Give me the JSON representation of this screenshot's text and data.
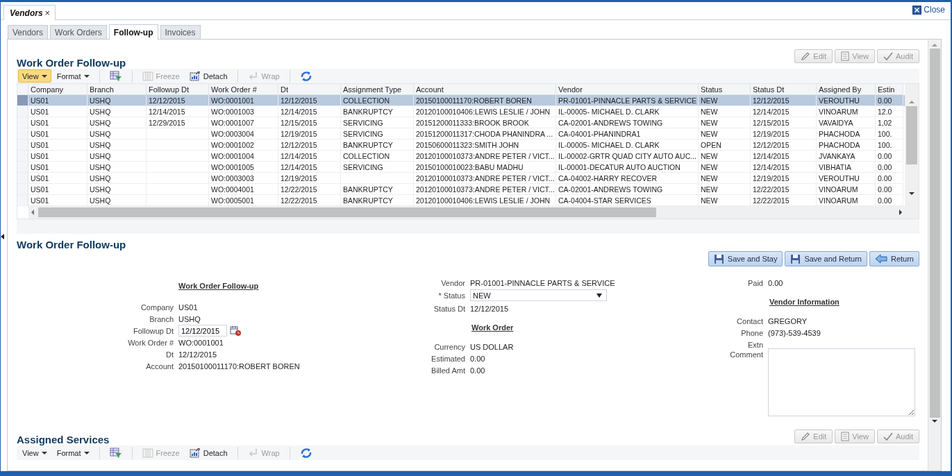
{
  "document_tab": {
    "label": "Vendors",
    "close": "×"
  },
  "close_link": "Close",
  "tabs": [
    {
      "label": "Vendors",
      "selected": false
    },
    {
      "label": "Work Orders",
      "selected": false
    },
    {
      "label": "Follow-up",
      "selected": true
    },
    {
      "label": "Invoices",
      "selected": false
    }
  ],
  "list_section": {
    "title": "Work Order Follow-up",
    "actions": [
      {
        "label": "Edit",
        "kind": "edit",
        "disabled": true
      },
      {
        "label": "View",
        "kind": "view",
        "disabled": true
      },
      {
        "label": "Audit",
        "kind": "audit",
        "disabled": true
      }
    ],
    "toolbar": [
      {
        "kind": "menu",
        "label": "View",
        "highlighted": true,
        "disabled": false
      },
      {
        "kind": "menu",
        "label": "Format",
        "highlighted": false,
        "disabled": false
      },
      {
        "kind": "filter",
        "highlighted": false,
        "disabled": false
      },
      {
        "kind": "freeze",
        "label": "Freeze",
        "highlighted": false,
        "disabled": true
      },
      {
        "kind": "detach",
        "label": "Detach",
        "highlighted": false,
        "disabled": false
      },
      {
        "kind": "wrap",
        "label": "Wrap",
        "highlighted": false,
        "disabled": true
      },
      {
        "kind": "refresh",
        "highlighted": false,
        "disabled": false
      }
    ]
  },
  "table": {
    "columns": [
      "Company",
      "Branch",
      "Followup Dt",
      "Work Order #",
      "Dt",
      "Assignment Type",
      "Account",
      "Vendor",
      "Status",
      "Status Dt",
      "Assigned By",
      "Estin"
    ],
    "rows": [
      {
        "selected": true,
        "cells": [
          "US01",
          "USHQ",
          "12/12/2015",
          "WO:0001001",
          "12/12/2015",
          "COLLECTION",
          "20150100011170:ROBERT BOREN",
          "PR-01001-PINNACLE PARTS & SERVICE",
          "NEW",
          "12/12/2015",
          "VEROUTHU",
          "0.00"
        ]
      },
      {
        "selected": false,
        "cells": [
          "US01",
          "USHQ",
          "12/14/2015",
          "WO:0001003",
          "12/14/2015",
          "BANKRUPTCY",
          "20120100010406:LEWIS LESLIE / JOHN",
          "IL-00005- MICHAEL D. CLARK",
          "NEW",
          "12/14/2015",
          "VINOARUM",
          "12.0"
        ]
      },
      {
        "selected": false,
        "cells": [
          "US01",
          "USHQ",
          "12/29/2015",
          "WO:0001007",
          "12/15/2015",
          "SERVICING",
          "20151200011333:BROOK BROOK",
          "CA-02001-ANDREWS TOWING",
          "NEW",
          "12/15/2015",
          "VAVAIDYA",
          "1,02"
        ]
      },
      {
        "selected": false,
        "cells": [
          "US01",
          "USHQ",
          "",
          "WO:0003004",
          "12/19/2015",
          "SERVICING",
          "20151200011317:CHODA PHANINDRA ...",
          "CA-04001-PHANINDRA1",
          "NEW",
          "12/19/2015",
          "PHACHODA",
          "100."
        ]
      },
      {
        "selected": false,
        "cells": [
          "US01",
          "USHQ",
          "",
          "WO:0001002",
          "12/12/2015",
          "BANKRUPTCY",
          "20150600011323:SMITH JOHN",
          "IL-00005- MICHAEL D. CLARK",
          "OPEN",
          "12/12/2015",
          "PHACHODA",
          "100."
        ]
      },
      {
        "selected": false,
        "cells": [
          "US01",
          "USHQ",
          "",
          "WO:0001004",
          "12/14/2015",
          "COLLECTION",
          "20120100010373:ANDRE PETER / VICT...",
          "IL-00002-GRTR QUAD CITY AUTO AUC...",
          "NEW",
          "12/14/2015",
          "JVANKAYA",
          "0.00"
        ]
      },
      {
        "selected": false,
        "cells": [
          "US01",
          "USHQ",
          "",
          "WO:0001005",
          "12/14/2015",
          "SERVICING",
          "20150100010023:BABU MADHU",
          "IL-00001-DECATUR AUTO AUCTION",
          "NEW",
          "12/14/2015",
          "VIBHATIA",
          "0.00"
        ]
      },
      {
        "selected": false,
        "cells": [
          "US01",
          "USHQ",
          "",
          "WO:0003003",
          "12/19/2015",
          "",
          "20120100010373:ANDRE PETER / VICT...",
          "CA-04002-HARRY RECOVER",
          "NEW",
          "12/19/2015",
          "VEROUTHU",
          "0.00"
        ]
      },
      {
        "selected": false,
        "cells": [
          "US01",
          "USHQ",
          "",
          "WO:0004001",
          "12/22/2015",
          "BANKRUPTCY",
          "20120100010373:ANDRE PETER / VICT...",
          "CA-02001-ANDREWS TOWING",
          "NEW",
          "12/22/2015",
          "VINOARUM",
          "0.00"
        ]
      },
      {
        "selected": false,
        "cells": [
          "US01",
          "USHQ",
          "",
          "WO:0005001",
          "12/22/2015",
          "BANKRUPTCY",
          "20120100010406:LEWIS LESLIE / JOHN",
          "CA-04004-STAR SERVICES",
          "NEW",
          "12/22/2015",
          "VINOARUM",
          "0.00"
        ]
      }
    ]
  },
  "detail_section": {
    "title": "Work Order Follow-up",
    "buttons": [
      {
        "label": "Save and Stay",
        "kind": "save"
      },
      {
        "label": "Save and Return",
        "kind": "save"
      },
      {
        "label": "Return",
        "kind": "return"
      }
    ],
    "column_1": {
      "heading": "Work Order Follow-up",
      "fields": [
        {
          "label": "Company",
          "value": "US01",
          "kind": "text"
        },
        {
          "label": "Branch",
          "value": "USHQ",
          "kind": "text"
        },
        {
          "label": "Followup Dt",
          "value": "12/12/2015",
          "kind": "date"
        },
        {
          "label": "Work Order #",
          "value": "WO:0001001",
          "kind": "text"
        },
        {
          "label": "Dt",
          "value": "12/12/2015",
          "kind": "text"
        },
        {
          "label": "Account",
          "value": "20150100011170:ROBERT BOREN",
          "kind": "text"
        }
      ]
    },
    "column_2": {
      "top_fields": [
        {
          "label": "Vendor",
          "value": "PR-01001-PINNACLE PARTS & SERVICE",
          "kind": "text"
        },
        {
          "label": "* Status",
          "value": "NEW",
          "kind": "select"
        },
        {
          "label": "Status Dt",
          "value": "12/12/2015",
          "kind": "text"
        }
      ],
      "heading": "Work Order",
      "fields": [
        {
          "label": "Currency",
          "value": "US DOLLAR",
          "kind": "text"
        },
        {
          "label": "Estimated",
          "value": "0.00",
          "kind": "text"
        },
        {
          "label": "Billed Amt",
          "value": "0.00",
          "kind": "text"
        }
      ]
    },
    "column_3": {
      "top_fields": [
        {
          "label": "Paid",
          "value": "0.00",
          "kind": "text"
        }
      ],
      "heading": "Vendor Information",
      "fields": [
        {
          "label": "Contact",
          "value": "GREGORY",
          "kind": "text"
        },
        {
          "label": "Phone",
          "value": "(973)-539-4539",
          "kind": "text"
        },
        {
          "label": "Extn",
          "kind": "text"
        },
        {
          "label": "Comment",
          "kind": "textarea"
        }
      ]
    }
  },
  "services_section": {
    "title": "Assigned Services",
    "actions": [
      {
        "label": "Edit",
        "kind": "edit",
        "disabled": true
      },
      {
        "label": "View",
        "kind": "view",
        "disabled": true
      },
      {
        "label": "Audit",
        "kind": "audit",
        "disabled": true
      }
    ],
    "toolbar": [
      {
        "kind": "menu",
        "label": "View",
        "highlighted": false,
        "disabled": false
      },
      {
        "kind": "menu",
        "label": "Format",
        "highlighted": false,
        "disabled": false
      },
      {
        "kind": "filter",
        "highlighted": false,
        "disabled": false
      },
      {
        "kind": "freeze",
        "label": "Freeze",
        "highlighted": false,
        "disabled": true
      },
      {
        "kind": "detach",
        "label": "Detach",
        "highlighted": false,
        "disabled": false
      },
      {
        "kind": "wrap",
        "label": "Wrap",
        "highlighted": false,
        "disabled": true
      },
      {
        "kind": "refresh",
        "highlighted": false,
        "disabled": false
      }
    ]
  }
}
